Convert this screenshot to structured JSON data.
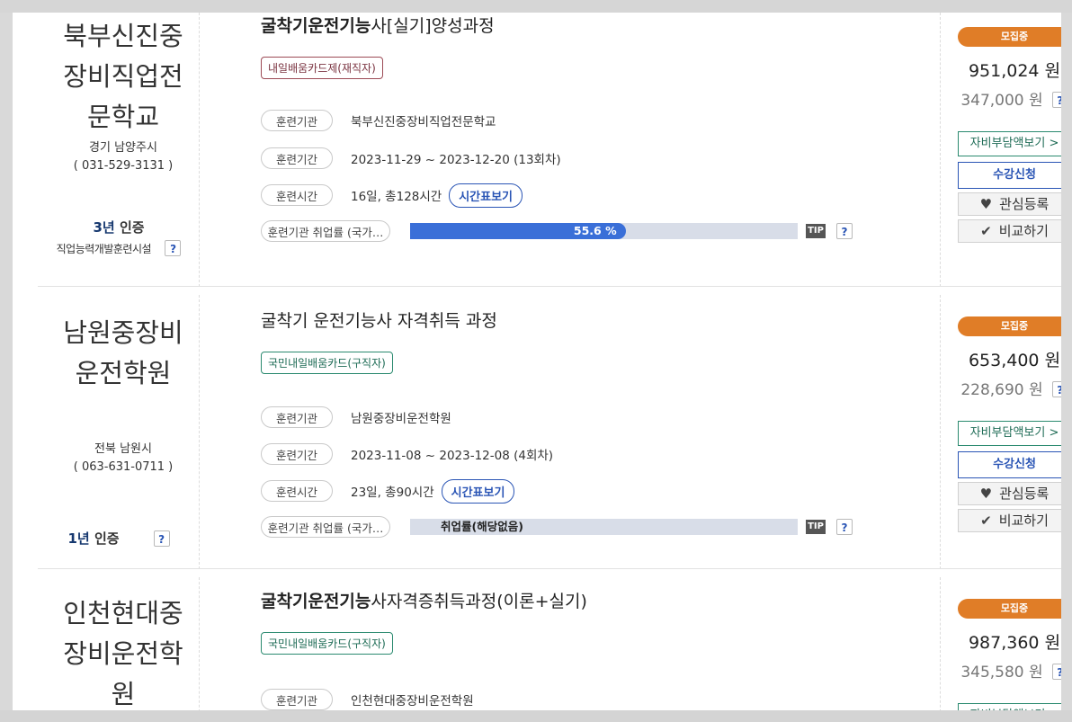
{
  "cards": [
    {
      "institution": {
        "name_lines": [
          "북부신진중",
          "장비직업전",
          "문학교"
        ],
        "location": "경기 남양주시",
        "phone": "( 031-529-3131 )"
      },
      "cert": {
        "years": "3년",
        "label": "인증",
        "subtitle": "직업능력개발훈련시설"
      },
      "course": {
        "title_bold": "굴착기운전기능",
        "title_rest": "사[실기]양성과정",
        "tag": "내일배움카드제(재직자)"
      },
      "rows": {
        "org_label": "훈련기관",
        "org_value": "북부신진중장비직업전문학교",
        "period_label": "훈련기간",
        "period_value": "2023-11-29 ~ 2023-12-20 (13회차)",
        "time_label": "훈련시간",
        "time_value": "16일, 총128시간",
        "time_button": "시간표보기",
        "emp_label": "훈련기관 취업률 (국가…"
      },
      "employment": {
        "rate": 55.6,
        "text": "55.6 %"
      },
      "status": "모집중",
      "price": "951,024 원",
      "self_pay": "347,000 원"
    },
    {
      "institution": {
        "name_lines": [
          "남원중장비",
          "운전학원"
        ],
        "location": "전북 남원시",
        "phone": "( 063-631-0711 )"
      },
      "cert": {
        "years": "1년",
        "label": "인증",
        "subtitle": ""
      },
      "course": {
        "title_bold": "",
        "title_rest": "굴착기 운전기능사 자격취득 과정",
        "tag": "국민내일배움카드(구직자)"
      },
      "rows": {
        "org_label": "훈련기관",
        "org_value": "남원중장비운전학원",
        "period_label": "훈련기간",
        "period_value": "2023-11-08 ~ 2023-12-08 (4회차)",
        "time_label": "훈련시간",
        "time_value": "23일, 총90시간",
        "time_button": "시간표보기",
        "emp_label": "훈련기관 취업률 (국가…"
      },
      "employment": {
        "rate": null,
        "text": "취업률(해당없음)"
      },
      "status": "모집중",
      "price": "653,400 원",
      "self_pay": "228,690 원"
    },
    {
      "institution": {
        "name_lines": [
          "인천현대중",
          "장비운전학",
          "원"
        ],
        "location": "",
        "phone": ""
      },
      "course": {
        "title_bold": "굴착기운전기능",
        "title_rest": "사자격증취득과정(이론+실기)",
        "tag": "국민내일배움카드(구직자)"
      },
      "rows": {
        "org_label": "훈련기관",
        "org_value": "인천현대중장비운전학원"
      },
      "status": "모집중",
      "price": "987,360 원",
      "self_pay": "345,580 원"
    }
  ],
  "common": {
    "share_button": "자비부담액보기 >",
    "apply_button": "수강신청",
    "like_button": "관심등록",
    "compare_button": "비교하기",
    "tip": "TIP",
    "help": "?"
  },
  "colors": {
    "status": "#e07d27",
    "bar": "#3a6fd8",
    "accent_blue": "#2a55b5",
    "accent_green": "#2a8a6f"
  },
  "icons": {
    "like": "heart-icon",
    "compare": "check-icon"
  }
}
